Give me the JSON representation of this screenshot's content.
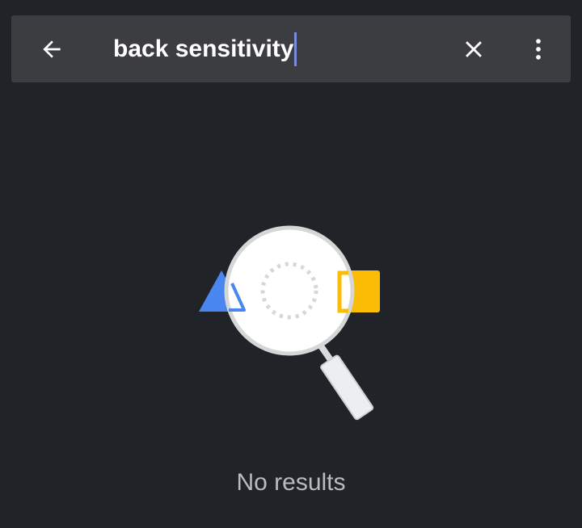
{
  "search": {
    "query": "back sensitivity"
  },
  "icons": {
    "back": "arrow-back-icon",
    "clear": "close-icon",
    "more": "more-vert-icon",
    "illustration": "magnifier-search-icon"
  },
  "colors": {
    "background": "#202328",
    "search_bar": "#3c3d40",
    "caret": "#7b8cdf",
    "shape_blue": "#4a86f0",
    "shape_yellow": "#fbbc05"
  },
  "empty_state": {
    "message": "No results"
  }
}
